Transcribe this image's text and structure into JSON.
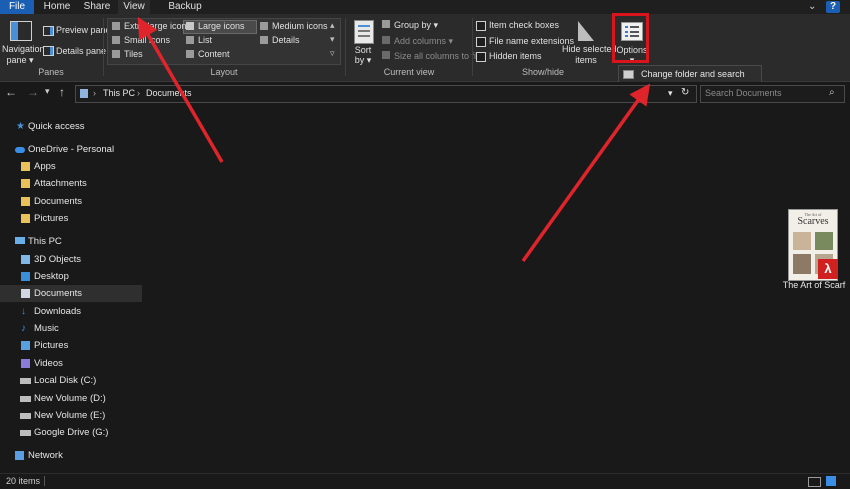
{
  "tabs": [
    "File",
    "Home",
    "Share",
    "View",
    "Backup Tools"
  ],
  "ribbon": {
    "panes": {
      "navigation_pane_line1": "Navigation",
      "navigation_pane_line2": "pane",
      "preview_pane": "Preview pane",
      "details_pane": "Details pane",
      "group_label": "Panes"
    },
    "layout": {
      "extra_large_icons": "Extra large icons",
      "large_icons": "Large icons",
      "medium_icons": "Medium icons",
      "small_icons": "Small icons",
      "list": "List",
      "details": "Details",
      "tiles": "Tiles",
      "content": "Content",
      "group_label": "Layout"
    },
    "current_view": {
      "sort_by_line1": "Sort",
      "sort_by_line2": "by",
      "group_by": "Group by",
      "add_columns": "Add columns",
      "size_all_columns": "Size all columns to fit",
      "group_label": "Current view"
    },
    "show_hide": {
      "item_check_boxes": "Item check boxes",
      "file_name_extensions": "File name extensions",
      "hidden_items": "Hidden items",
      "hide_selected_line1": "Hide selected",
      "hide_selected_line2": "items",
      "group_label": "Show/hide"
    },
    "options": {
      "label": "Options",
      "tooltip": "Change folder and search options"
    }
  },
  "address": {
    "path": [
      "This PC",
      "Documents"
    ],
    "search_placeholder": "Search Documents"
  },
  "sidebar": {
    "items": [
      {
        "label": "Quick access",
        "icon": "star-icon"
      },
      {
        "label": "OneDrive - Personal",
        "icon": "cloud-icon"
      },
      {
        "label": "Apps",
        "icon": "folder-icon"
      },
      {
        "label": "Attachments",
        "icon": "folder-icon"
      },
      {
        "label": "Documents",
        "icon": "folder-icon"
      },
      {
        "label": "Pictures",
        "icon": "folder-icon"
      },
      {
        "label": "This PC",
        "icon": "computer-icon"
      },
      {
        "label": "3D Objects",
        "icon": "cube-icon"
      },
      {
        "label": "Desktop",
        "icon": "desktop-icon"
      },
      {
        "label": "Documents",
        "icon": "document-icon"
      },
      {
        "label": "Downloads",
        "icon": "download-icon"
      },
      {
        "label": "Music",
        "icon": "music-icon"
      },
      {
        "label": "Pictures",
        "icon": "picture-icon"
      },
      {
        "label": "Videos",
        "icon": "video-icon"
      },
      {
        "label": "Local Disk (C:)",
        "icon": "disk-icon"
      },
      {
        "label": "New Volume (D:)",
        "icon": "disk-icon"
      },
      {
        "label": "New Volume (E:)",
        "icon": "disk-icon"
      },
      {
        "label": "Google Drive (G:)",
        "icon": "disk-icon"
      },
      {
        "label": "Network",
        "icon": "network-icon"
      }
    ]
  },
  "content": {
    "file": {
      "name": "The Art of Scarf",
      "thumb_small": "The Art of",
      "thumb_title": "Scarves"
    }
  },
  "status": {
    "item_count": "20 items"
  },
  "colors": {
    "accent": "#1a5fb4",
    "highlight_red": "#d8141c",
    "arrow_red": "#e0242b"
  }
}
